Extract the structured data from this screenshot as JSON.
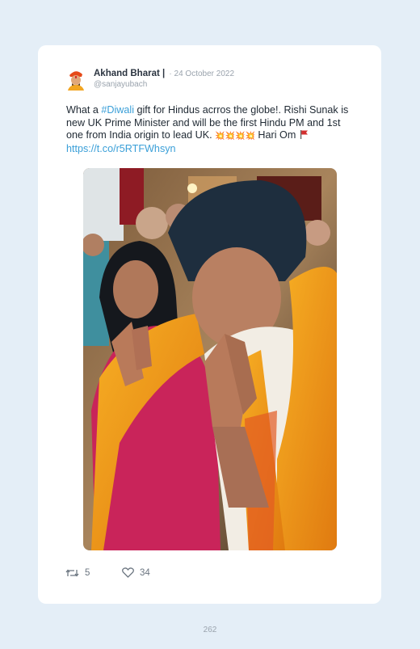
{
  "tweet": {
    "author_name": "Akhand Bharat |",
    "date": "· 24 October 2022",
    "handle": "@sanjayubach",
    "text_1": "What a ",
    "hashtag": "#Diwali",
    "text_2": " gift for Hindus acrros the globe!. Rishi Sunak is new UK Prime Minister and will be the first Hindu PM and 1st one from India origin to lead UK. ",
    "emoji": "💥💥💥💥",
    "text_3": " Hari Om ",
    "link": "https://t.co/r5RTFWhsyn",
    "retweets": "5",
    "likes": "34"
  },
  "page_number": "262",
  "colors": {
    "background": "#e4eef7",
    "card": "#ffffff",
    "link": "#3a9fd8",
    "muted": "#9aa3ad"
  },
  "icons": [
    "avatar-icon",
    "flag-icon",
    "retweet-icon",
    "heart-icon"
  ]
}
